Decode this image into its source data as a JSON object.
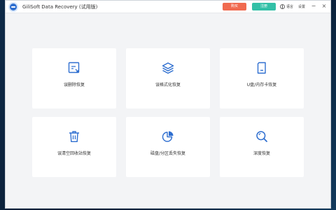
{
  "app": {
    "title": "GiliSoft Data Recovery (试用版)"
  },
  "titlebar": {
    "buy_label": "购买",
    "register_label": "注册",
    "language_label": "语言",
    "settings_label": "设置",
    "minimize_icon": "−",
    "close_icon": "×"
  },
  "accent": "#2f6fd0",
  "cards": [
    {
      "label": "误删除恢复",
      "icon": "deleted-file-recovery-icon"
    },
    {
      "label": "误格式化恢复",
      "icon": "layers-icon"
    },
    {
      "label": "U盘/内存卡恢复",
      "icon": "sd-card-icon"
    },
    {
      "label": "误清空回收站恢复",
      "icon": "trash-icon"
    },
    {
      "label": "磁盘/分区丢失恢复",
      "icon": "pie-chart-icon"
    },
    {
      "label": "深度恢复",
      "icon": "magnifier-icon"
    }
  ]
}
